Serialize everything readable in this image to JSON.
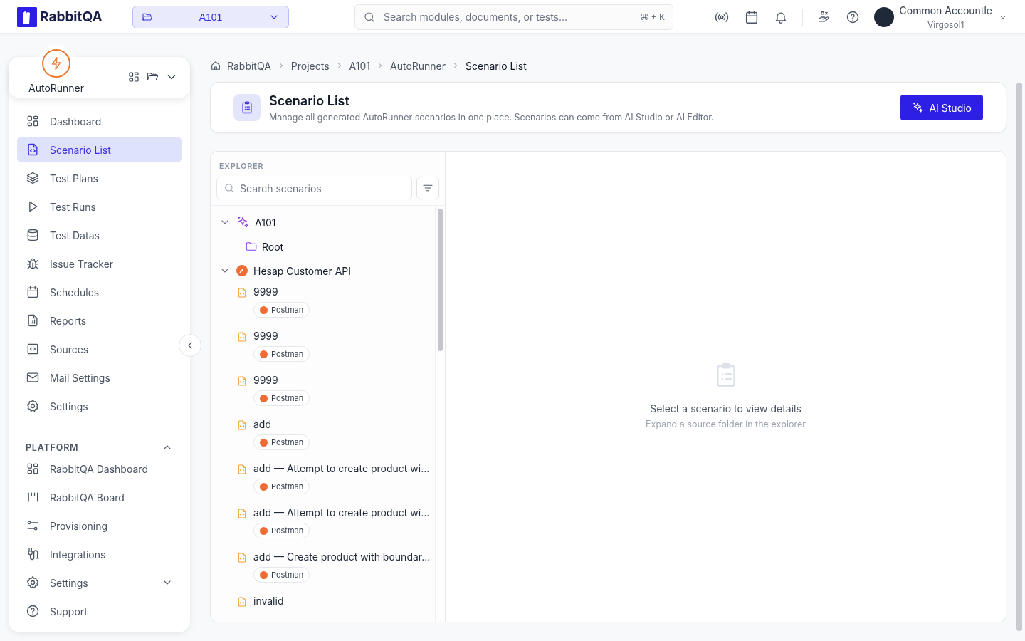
{
  "header": {
    "brand": "RabbitQA",
    "project": "A101",
    "search": {
      "placeholder": "Search modules, documents, or tests...",
      "shortcut": "⌘ + K"
    },
    "user": {
      "name": "Common Accountle",
      "org": "Virgosol1"
    }
  },
  "sidebar": {
    "module": "AutoRunner",
    "items": [
      {
        "label": "Dashboard",
        "selected": false
      },
      {
        "label": "Scenario List",
        "selected": true
      },
      {
        "label": "Test Plans",
        "selected": false
      },
      {
        "label": "Test Runs",
        "selected": false
      },
      {
        "label": "Test Datas",
        "selected": false
      },
      {
        "label": "Issue Tracker",
        "selected": false
      },
      {
        "label": "Schedules",
        "selected": false
      },
      {
        "label": "Reports",
        "selected": false
      },
      {
        "label": "Sources",
        "selected": false
      },
      {
        "label": "Mail Settings",
        "selected": false
      },
      {
        "label": "Settings",
        "selected": false
      }
    ],
    "platform": {
      "title": "PLATFORM",
      "expanded": true,
      "items": [
        {
          "label": "RabbitQA Dashboard",
          "kind": "link"
        },
        {
          "label": "RabbitQA Board",
          "kind": "link"
        },
        {
          "label": "Provisioning",
          "kind": "link"
        },
        {
          "label": "Integrations",
          "kind": "link"
        },
        {
          "label": "Settings",
          "kind": "group",
          "expanded": false
        },
        {
          "label": "Support",
          "kind": "link"
        }
      ]
    }
  },
  "breadcrumb": [
    "RabbitQA",
    "Projects",
    "A101",
    "AutoRunner",
    "Scenario List"
  ],
  "page": {
    "title": "Scenario List",
    "subtitle": "Manage all generated AutoRunner scenarios in one place. Scenarios can come from AI Studio or AI Editor.",
    "action": "AI Studio"
  },
  "explorer": {
    "title": "EXPLORER",
    "search": {
      "placeholder": "Search scenarios"
    },
    "tree": [
      {
        "label": "A101",
        "kind": "project",
        "expanded": true,
        "children": [
          {
            "label": "Root",
            "kind": "folder"
          }
        ]
      },
      {
        "label": "Hesap Customer API",
        "kind": "source",
        "expanded": true,
        "children": [
          {
            "label": "9999",
            "kind": "scenario",
            "source": "Postman"
          },
          {
            "label": "9999",
            "kind": "scenario",
            "source": "Postman"
          },
          {
            "label": "9999",
            "kind": "scenario",
            "source": "Postman"
          },
          {
            "label": "add",
            "kind": "scenario",
            "source": "Postman"
          },
          {
            "label": "add — Attempt to create product wi...",
            "kind": "scenario",
            "source": "Postman"
          },
          {
            "label": "add — Attempt to create product wi...",
            "kind": "scenario",
            "source": "Postman"
          },
          {
            "label": "add — Create product with boundar...",
            "kind": "scenario",
            "source": "Postman"
          },
          {
            "label": "invalid",
            "kind": "scenario"
          }
        ]
      }
    ]
  },
  "detail": {
    "title": "Select a scenario to view details",
    "hint": "Expand a source folder in the explorer"
  }
}
